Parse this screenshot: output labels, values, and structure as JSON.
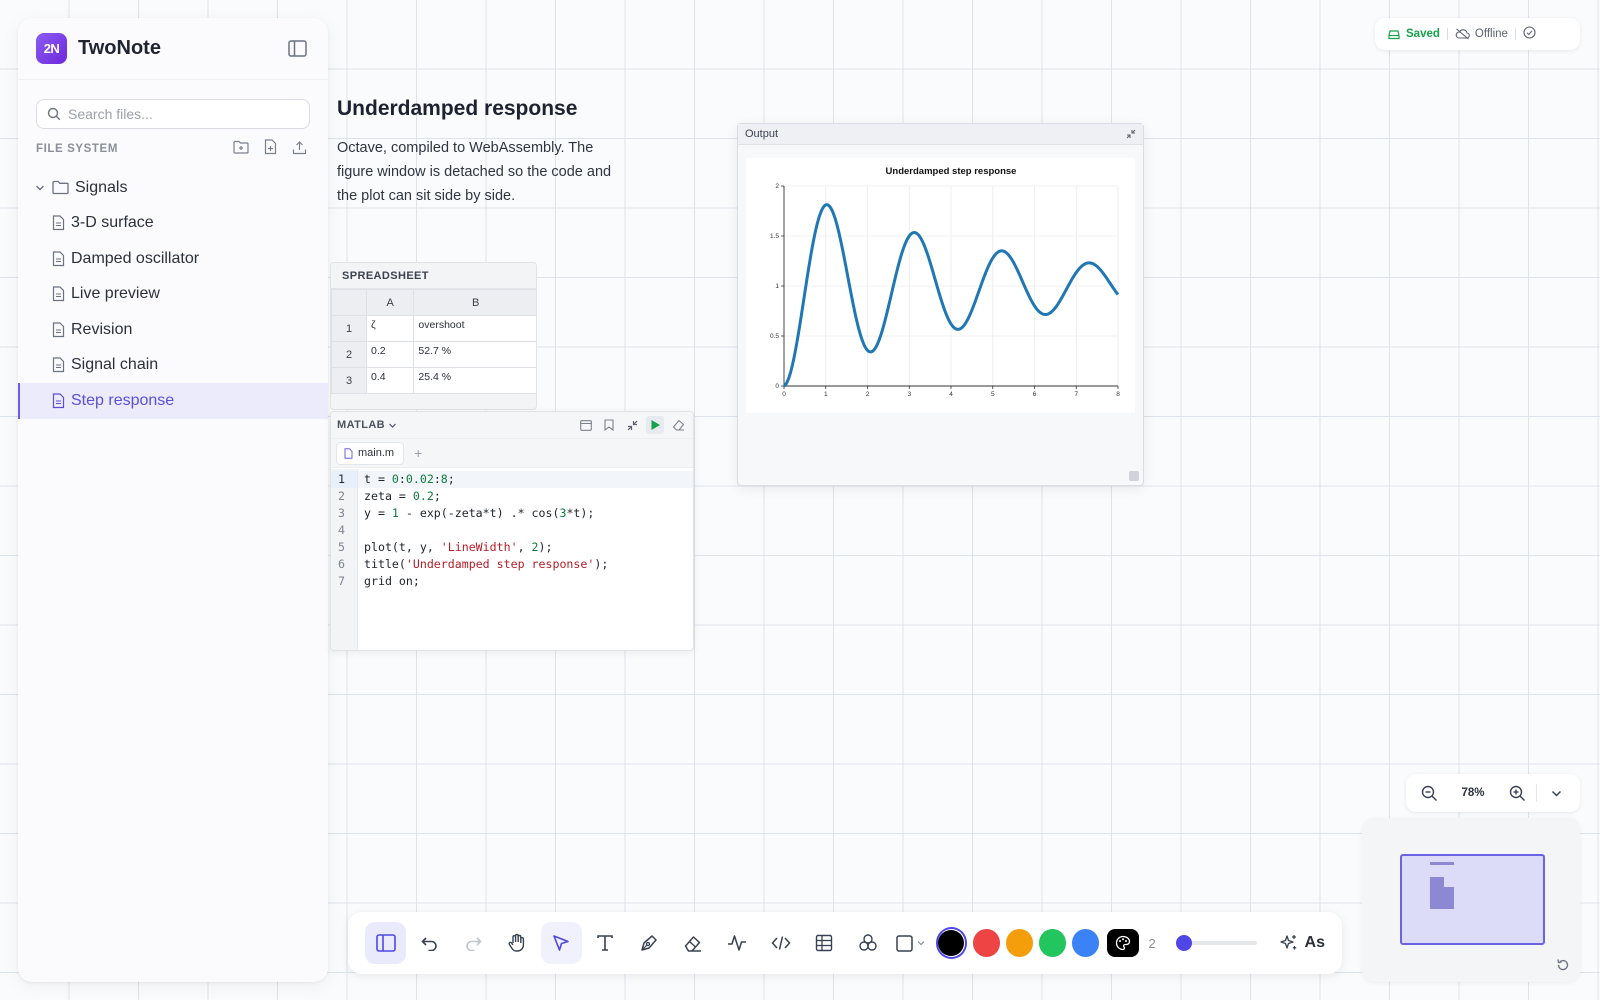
{
  "app": {
    "name": "TwoNote",
    "logo_text": "2N"
  },
  "sidebar": {
    "search_placeholder": "Search files...",
    "section_label": "FILE SYSTEM",
    "folder": {
      "label": "Signals",
      "expanded": true
    },
    "files": [
      {
        "label": "3-D surface",
        "active": false
      },
      {
        "label": "Damped oscillator",
        "active": false
      },
      {
        "label": "Live preview",
        "active": false
      },
      {
        "label": "Revision",
        "active": false
      },
      {
        "label": "Signal chain",
        "active": false
      },
      {
        "label": "Step response",
        "active": true
      }
    ]
  },
  "note": {
    "title": "Underdamped response",
    "body": "Octave, compiled to WebAssembly. The figure window is detached so the code and the plot can sit side by side."
  },
  "spreadsheet": {
    "title": "SPREADSHEET",
    "columns": [
      "A",
      "B"
    ],
    "rows": [
      {
        "num": "1",
        "a": "ζ",
        "b": "overshoot"
      },
      {
        "num": "2",
        "a": "0.2",
        "b": "52.7 %"
      },
      {
        "num": "3",
        "a": "0.4",
        "b": "25.4 %"
      }
    ]
  },
  "editor": {
    "language": "MATLAB",
    "tab": "main.m",
    "add_tab": "+",
    "lines": [
      "1",
      "2",
      "3",
      "4",
      "5",
      "6",
      "7"
    ]
  },
  "output": {
    "title": "Output"
  },
  "chart_data": {
    "type": "line",
    "title": "Underdamped step response",
    "xlabel": "",
    "ylabel": "",
    "xlim": [
      0,
      8
    ],
    "ylim": [
      0,
      2
    ],
    "xticks": [
      "0",
      "1",
      "2",
      "3",
      "4",
      "5",
      "6",
      "7",
      "8"
    ],
    "yticks": [
      "0",
      "0.5",
      "1",
      "1.5",
      "2"
    ],
    "grid": true,
    "series": [
      {
        "formula": "y = 1 - exp(-0.2*t) .* cos(3*t)",
        "x_start": 0,
        "x_end": 8,
        "x_step": 0.02,
        "sample_points": [
          {
            "x": 0,
            "y": 0
          },
          {
            "x": 1.05,
            "y": 1.8
          },
          {
            "x": 2.09,
            "y": 0.34
          },
          {
            "x": 3.14,
            "y": 1.53
          },
          {
            "x": 4.19,
            "y": 0.57
          },
          {
            "x": 5.24,
            "y": 1.35
          },
          {
            "x": 6.28,
            "y": 0.71
          },
          {
            "x": 7.33,
            "y": 1.23
          },
          {
            "x": 8,
            "y": 0.91
          }
        ],
        "color": "#1f77b4"
      }
    ]
  },
  "status": {
    "saved": "Saved",
    "offline": "Offline"
  },
  "zoom": {
    "level": "78%"
  },
  "toolbar": {
    "stroke_width": "2",
    "ai_label": "As",
    "colors": [
      "#000000",
      "#ef4444",
      "#f59e0b",
      "#22c55e",
      "#3b82f6"
    ],
    "accent": "#4f46e5"
  }
}
